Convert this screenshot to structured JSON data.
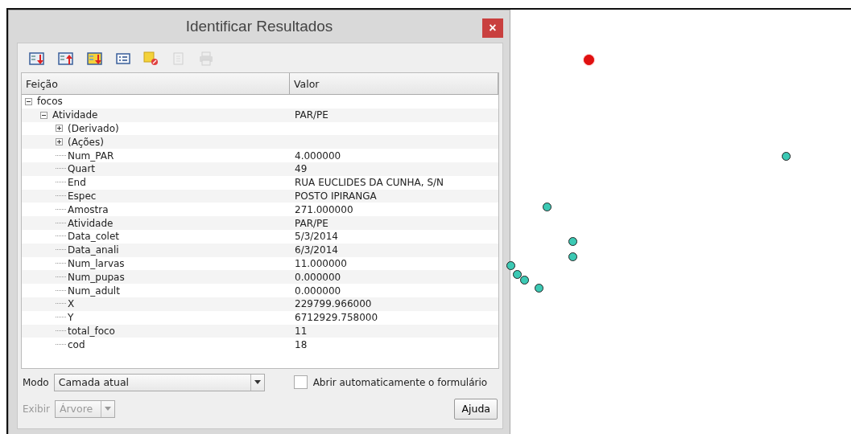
{
  "window": {
    "title": "Identificar Resultados",
    "close": "×"
  },
  "toolbar": [
    {
      "kind": "expand-tree",
      "disabled": false
    },
    {
      "kind": "collapse-tree",
      "disabled": false
    },
    {
      "kind": "expand-new",
      "disabled": false
    },
    {
      "kind": "list",
      "disabled": false
    },
    {
      "kind": "clear",
      "disabled": false
    },
    {
      "kind": "copy",
      "disabled": true
    },
    {
      "kind": "print",
      "disabled": true
    }
  ],
  "table": {
    "columns": [
      "Feição",
      "Valor"
    ],
    "tree": [
      {
        "label": "focos",
        "expanded": true,
        "children": [
          {
            "label": "Atividade",
            "value": "PAR/PE",
            "expanded": true,
            "children": [
              {
                "label": "(Derivado)",
                "expanded": false
              },
              {
                "label": "(Ações)",
                "expanded": false
              },
              {
                "label": "Num_PAR",
                "value": "4.000000"
              },
              {
                "label": "Quart",
                "value": "49"
              },
              {
                "label": "End",
                "value": "RUA EUCLIDES DA CUNHA, S/N"
              },
              {
                "label": "Espec",
                "value": "POSTO IPIRANGA"
              },
              {
                "label": "Amostra",
                "value": "271.000000"
              },
              {
                "label": "Atividade",
                "value": "PAR/PE"
              },
              {
                "label": "Data_colet",
                "value": "5/3/2014"
              },
              {
                "label": "Data_anali",
                "value": "6/3/2014"
              },
              {
                "label": "Num_larvas",
                "value": "11.000000"
              },
              {
                "label": "Num_pupas",
                "value": "0.000000"
              },
              {
                "label": "Num_adult",
                "value": "0.000000"
              },
              {
                "label": "X",
                "value": "229799.966000"
              },
              {
                "label": "Y",
                "value": "6712929.758000"
              },
              {
                "label": "total_foco",
                "value": "11"
              },
              {
                "label": "cod",
                "value": "18"
              }
            ]
          }
        ]
      }
    ]
  },
  "mode": {
    "label": "Modo",
    "value": "Camada atual"
  },
  "auto_open": {
    "label": "Abrir automaticamente o formulário",
    "checked": false
  },
  "view": {
    "label": "Exibir",
    "value": "Árvore",
    "disabled": true
  },
  "help_button": "Ajuda",
  "map": {
    "points": [
      {
        "selected": true
      },
      {
        "selected": false
      },
      {
        "selected": false
      },
      {
        "selected": false
      },
      {
        "selected": false
      },
      {
        "selected": false
      },
      {
        "selected": false
      },
      {
        "selected": false
      },
      {
        "selected": false
      }
    ]
  }
}
